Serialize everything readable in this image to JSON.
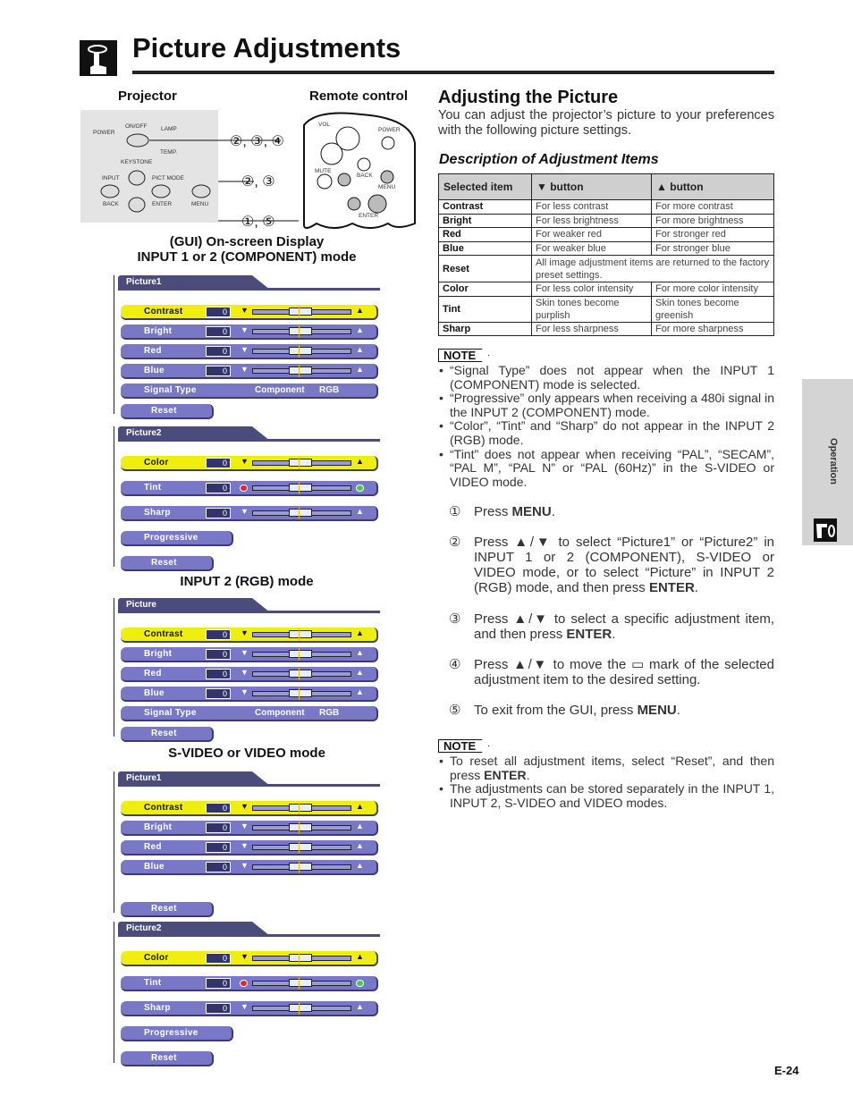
{
  "header": {
    "title": "Picture Adjustments"
  },
  "left": {
    "projector_label": "Projector",
    "remote_label": "Remote control",
    "projector_buttons": [
      "POWER",
      "ON/OFF",
      "LAMP",
      "TEMP.",
      "KEYSTONE",
      "INPUT",
      "PICT MODE",
      "BACK",
      "ENTER",
      "MENU"
    ],
    "remote_buttons": [
      "VOL",
      "POWER",
      "MUTE",
      "BACK",
      "MENU",
      "ENTER"
    ],
    "callouts": [
      "②, ③, ④",
      "②, ③",
      "①, ⑤"
    ],
    "gui_title": "(GUI) On-screen Display",
    "sec1": "INPUT 1 or 2 (COMPONENT) mode",
    "sec2": "INPUT 2 (RGB) mode",
    "sec3": "S-VIDEO or VIDEO mode",
    "menus": [
      {
        "title": "Picture1",
        "items": [
          {
            "label": "Contrast",
            "type": "slider",
            "value": "0",
            "selected": true
          },
          {
            "label": "Bright",
            "type": "slider",
            "value": "0"
          },
          {
            "label": "Red",
            "type": "slider",
            "value": "0"
          },
          {
            "label": "Blue",
            "type": "slider",
            "value": "0"
          },
          {
            "label": "Signal Type",
            "type": "options",
            "options": [
              "Component",
              "RGB"
            ]
          },
          {
            "label": "Reset",
            "type": "button"
          }
        ]
      },
      {
        "title": "Picture2",
        "items": [
          {
            "label": "Color",
            "type": "slider",
            "value": "0",
            "selected": true
          },
          {
            "label": "Tint",
            "type": "tint",
            "value": "0"
          },
          {
            "label": "Sharp",
            "type": "slider",
            "value": "0"
          },
          {
            "label": "Progressive",
            "type": "wide"
          },
          {
            "label": "Reset",
            "type": "button"
          }
        ]
      },
      {
        "title": "Picture",
        "items": [
          {
            "label": "Contrast",
            "type": "slider",
            "value": "0",
            "selected": true
          },
          {
            "label": "Bright",
            "type": "slider",
            "value": "0"
          },
          {
            "label": "Red",
            "type": "slider",
            "value": "0"
          },
          {
            "label": "Blue",
            "type": "slider",
            "value": "0"
          },
          {
            "label": "Signal Type",
            "type": "options",
            "options": [
              "Component",
              "RGB"
            ]
          },
          {
            "label": "Reset",
            "type": "button"
          }
        ]
      },
      {
        "title": "Picture1",
        "items": [
          {
            "label": "Contrast",
            "type": "slider",
            "value": "0",
            "selected": true
          },
          {
            "label": "Bright",
            "type": "slider",
            "value": "0"
          },
          {
            "label": "Red",
            "type": "slider",
            "value": "0"
          },
          {
            "label": "Blue",
            "type": "slider",
            "value": "0"
          },
          {
            "label": "Reset",
            "type": "button"
          }
        ]
      },
      {
        "title": "Picture2",
        "items": [
          {
            "label": "Color",
            "type": "slider",
            "value": "0",
            "selected": true
          },
          {
            "label": "Tint",
            "type": "tint",
            "value": "0"
          },
          {
            "label": "Sharp",
            "type": "slider",
            "value": "0"
          },
          {
            "label": "Progressive",
            "type": "wide"
          },
          {
            "label": "Reset",
            "type": "button"
          }
        ]
      }
    ]
  },
  "right": {
    "heading": "Adjusting the Picture",
    "intro": "You can adjust the projector’s picture to your preferences with the following picture settings.",
    "desc_heading": "Description of Adjustment Items",
    "table": {
      "headers": [
        "Selected item",
        "▼ button",
        "▲ button"
      ],
      "rows": [
        [
          "Contrast",
          "For less contrast",
          "For more contrast"
        ],
        [
          "Bright",
          "For less brightness",
          "For more brightness"
        ],
        [
          "Red",
          "For weaker red",
          "For stronger red"
        ],
        [
          "Blue",
          "For weaker blue",
          "For stronger blue"
        ],
        [
          "Reset",
          "All image adjustment items are returned to the factory preset settings."
        ],
        [
          "Color",
          "For less color intensity",
          "For more color intensity"
        ],
        [
          "Tint",
          "Skin tones become purplish",
          "Skin tones become greenish"
        ],
        [
          "Sharp",
          "For less sharpness",
          "For more sharpness"
        ]
      ]
    },
    "note_label": "NOTE",
    "note1": [
      "“Signal Type” does not appear when the INPUT 1 (COMPONENT) mode is selected.",
      "“Progressive” only appears when receiving a 480i signal in the INPUT 2 (COMPONENT) mode.",
      "“Color”, “Tint” and “Sharp” do not appear in the INPUT 2 (RGB) mode.",
      "“Tint” does not appear when receiving “PAL”, “SECAM”, “PAL M”, “PAL N” or “PAL (60Hz)” in the S-VIDEO or VIDEO mode."
    ],
    "steps": [
      {
        "num": "①",
        "html": "Press <b>MENU</b>."
      },
      {
        "num": "②",
        "html": "Press ▲/▼ to select “Picture1” or “Picture2” in INPUT 1 or 2 (COMPONENT), S-VIDEO or VIDEO mode, or to select “Picture” in INPUT 2 (RGB) mode, and then press <b>ENTER</b>."
      },
      {
        "num": "③",
        "html": "Press ▲/▼ to select a specific adjustment item, and then press <b>ENTER</b>."
      },
      {
        "num": "④",
        "html": "Press ▲/▼ to move the ▭ mark of the selected adjustment item to the desired setting."
      },
      {
        "num": "⑤",
        "html": "To exit from the GUI, press <b>MENU</b>."
      }
    ],
    "note2": [
      "To reset all adjustment items, select “Reset”, and then press <b>ENTER</b>.",
      "The adjustments can be stored separately in the INPUT 1, INPUT 2, S-VIDEO and VIDEO modes."
    ]
  },
  "side_tab": {
    "label": "Operation"
  },
  "footer": {
    "page": "E-24"
  }
}
